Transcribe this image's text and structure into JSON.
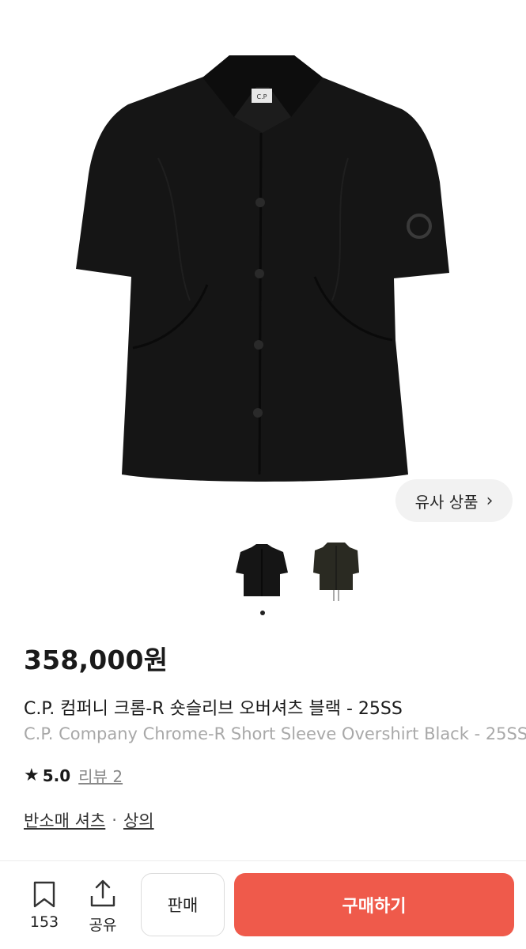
{
  "product": {
    "price": "358,000원",
    "title_ko": "C.P. 컴퍼니 크롬-R 숏슬리브 오버셔츠 블랙 - 25SS",
    "title_en": "C.P. Company Chrome-R Short Sleeve Overshirt Black - 25SS",
    "rating": {
      "star_icon": "★",
      "score": "5.0",
      "review_label": "리뷰 2"
    },
    "categories": [
      "반소매 셔츠",
      "상의"
    ],
    "category_separator": "·"
  },
  "gallery": {
    "similar_button_label": "유사 상품",
    "similar_button_chevron": "›",
    "thumbnail_count": 2,
    "active_index": 0
  },
  "bottom_bar": {
    "bookmark_count": "153",
    "share_label": "공유",
    "sell_label": "판매",
    "buy_label": "구매하기"
  },
  "colors": {
    "accent": "#ef5a4b",
    "garment": "#141414"
  }
}
